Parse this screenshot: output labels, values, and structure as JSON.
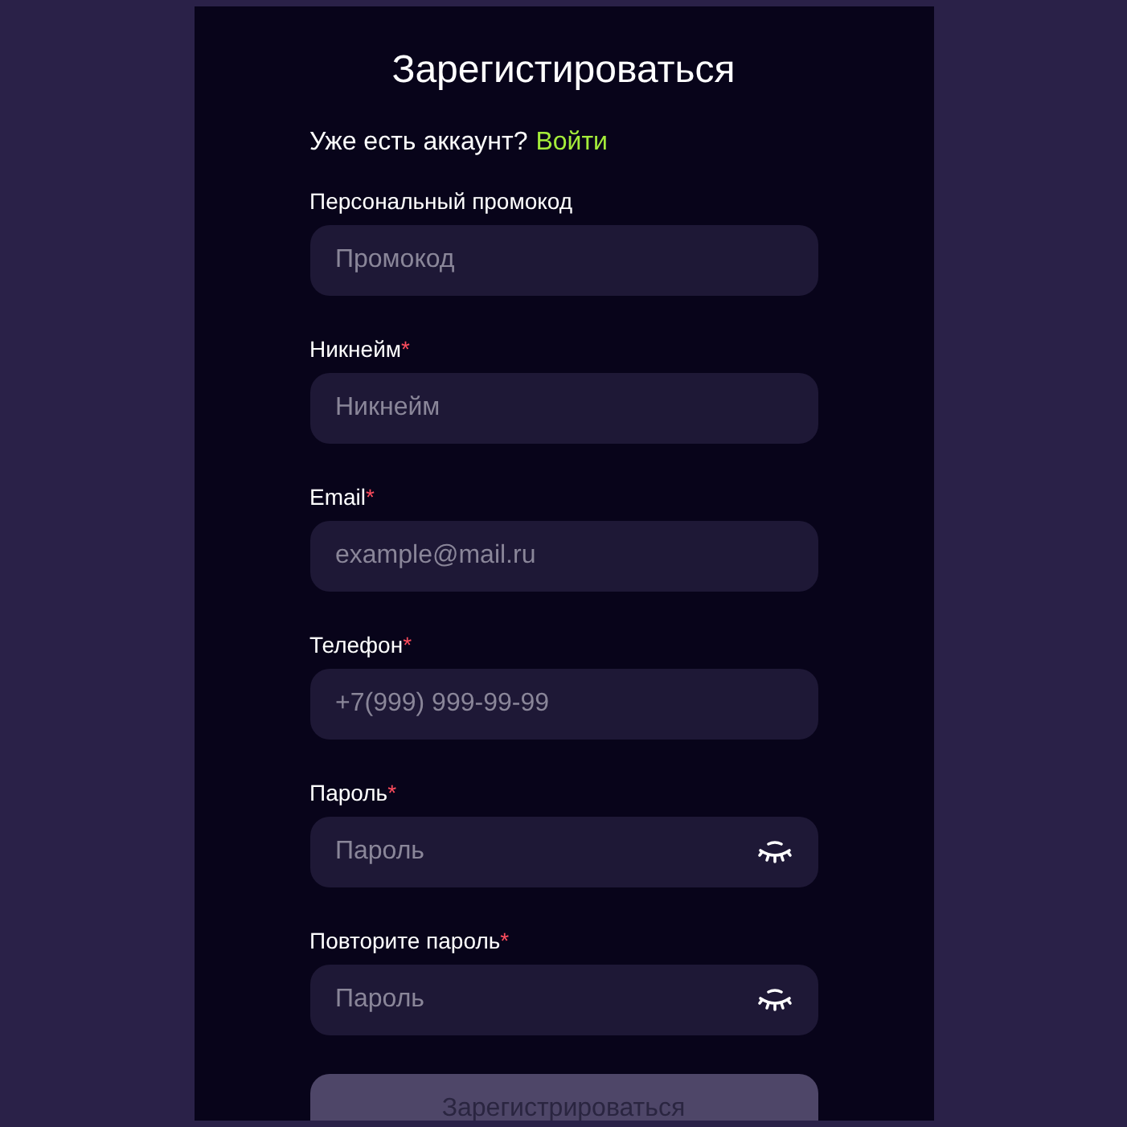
{
  "title": "Зарегистироваться",
  "login_prompt": {
    "text": "Уже есть аккаунт?",
    "link": "Войти"
  },
  "fields": [
    {
      "kind": "text",
      "label": "Персональный промокод",
      "required": false,
      "placeholder": "Промокод"
    },
    {
      "kind": "text",
      "label": "Никнейм",
      "required": true,
      "placeholder": "Никнейм"
    },
    {
      "kind": "text",
      "label": "Email",
      "required": true,
      "placeholder": "example@mail.ru"
    },
    {
      "kind": "text",
      "label": "Телефон",
      "required": true,
      "placeholder": "+7(999) 999-99-99"
    },
    {
      "kind": "password",
      "label": "Пароль",
      "required": true,
      "placeholder": "Пароль",
      "visible": false
    },
    {
      "kind": "password",
      "label": "Повторите пароль",
      "required": true,
      "placeholder": "Пароль",
      "visible": false
    }
  ],
  "required_mark": "*",
  "submit": {
    "label": "Зарегистрироваться",
    "disabled": true
  }
}
